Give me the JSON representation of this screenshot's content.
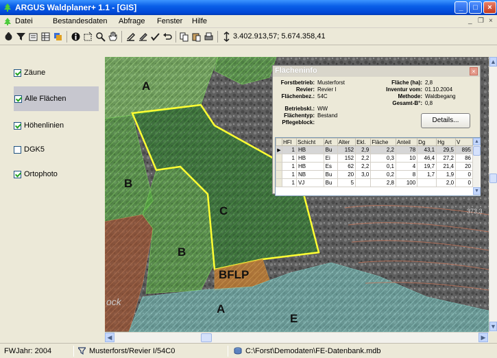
{
  "window": {
    "title": "ARGUS Waldplaner+ 1.1 - [GIS]",
    "min_glyph": "_",
    "max_glyph": "□",
    "close_glyph": "×"
  },
  "menu": {
    "items": [
      "Datei",
      "Bestandesdaten",
      "Abfrage",
      "Fenster",
      "Hilfe"
    ],
    "mdi_min": "_",
    "mdi_restore": "❐",
    "mdi_close": "×"
  },
  "toolbar": {
    "coordinates": "3.402.913,57; 5.674.358,41"
  },
  "layers": [
    {
      "label": "Zäune",
      "checked": true
    },
    {
      "label": "Alle Flächen",
      "checked": true,
      "selected": true
    },
    {
      "label": "Höhenlinien",
      "checked": true
    },
    {
      "label": "DGK5",
      "checked": false
    },
    {
      "label": "Ortophoto",
      "checked": true
    }
  ],
  "map": {
    "labels": [
      "A",
      "B",
      "C",
      "B",
      "BFLP",
      "A",
      "E"
    ],
    "contour_labels": [
      "373,3"
    ],
    "partial_labels": [
      "ock"
    ]
  },
  "info": {
    "title": "Flächeninfo",
    "close_glyph": "×",
    "fields_left": [
      {
        "label": "Forstbetrieb:",
        "value": "Musterforst"
      },
      {
        "label": "Revier:",
        "value": "Revier I"
      },
      {
        "label": "Flächenbez.:",
        "value": "54C"
      },
      {
        "label": "Betriebskl.:",
        "value": "WW"
      },
      {
        "label": "Flächentyp:",
        "value": "Bestand"
      },
      {
        "label": "Pflegeblock:",
        "value": ""
      }
    ],
    "fields_right": [
      {
        "label": "Fläche (ha):",
        "value": "2,8"
      },
      {
        "label": "Inventur vom:",
        "value": "01.10.2004"
      },
      {
        "label": "Methode:",
        "value": "Waldbegang"
      },
      {
        "label": "Gesamt-B°:",
        "value": "0,8"
      }
    ],
    "details_button": "Details...",
    "table": {
      "columns": [
        "HFl",
        "Schicht",
        "Art",
        "Alter",
        "Ekl.",
        "Fläche",
        "Anteil",
        "Dg",
        "Hg",
        "V"
      ],
      "rows": [
        [
          "1",
          "HB",
          "Bu",
          "152",
          "2,9",
          "2,2",
          "78",
          "43,1",
          "29,5",
          "895"
        ],
        [
          "1",
          "HB",
          "Ei",
          "152",
          "2,2",
          "0,3",
          "10",
          "46,4",
          "27,2",
          "86"
        ],
        [
          "1",
          "HB",
          "Es",
          "62",
          "2,2",
          "0,1",
          "4",
          "19,7",
          "21,4",
          "20"
        ],
        [
          "1",
          "NB",
          "Bu",
          "20",
          "3,0",
          "0,2",
          "8",
          "1,7",
          "1,9",
          "0"
        ],
        [
          "1",
          "VJ",
          "Bu",
          "5",
          "",
          "2,8",
          "100",
          "",
          "2,0",
          "0"
        ]
      ],
      "selected_row": 0
    }
  },
  "status": {
    "year": "FWJahr: 2004",
    "filter": "Musterforst/Revier I/54C0",
    "path": "C:\\Forst\\Demodaten\\FE-Datenbank.mdb"
  },
  "colors": {
    "title_bar": "#0A5FE8",
    "selected_area_outline": "#FFFF33",
    "green_area": "#3A9A2E",
    "brown_area": "#8A4B2E"
  }
}
